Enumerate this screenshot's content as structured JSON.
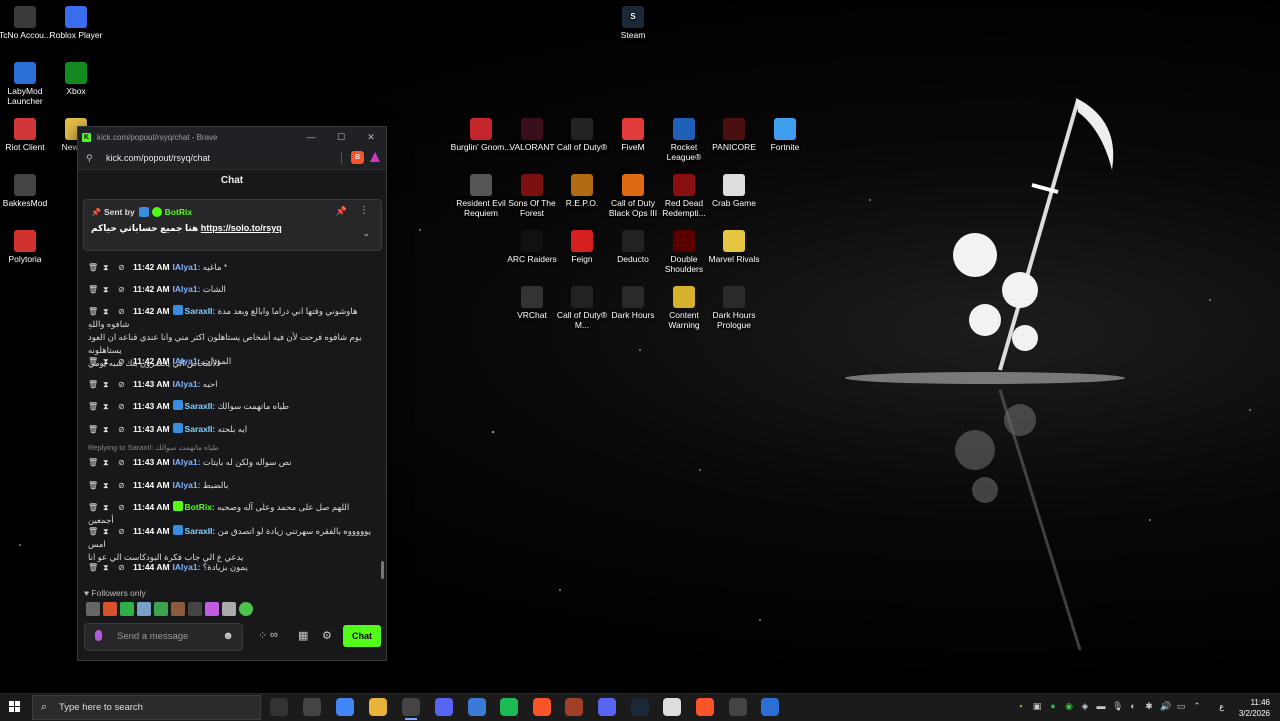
{
  "desktop": {
    "left_icons": [
      {
        "label": "TcNo Accou...",
        "icon": "tcno-icon",
        "color": "#3a3a3a"
      },
      {
        "label": "Roblox Player",
        "icon": "roblox-icon",
        "color": "#3b6df0"
      },
      {
        "label": "LabyMod Launcher",
        "icon": "labymod-icon",
        "color": "#2b6fd6"
      },
      {
        "label": "Xbox",
        "icon": "xbox-icon",
        "color": "#138a1e"
      },
      {
        "label": "Riot Client",
        "icon": "riot-icon",
        "color": "#d13639"
      },
      {
        "label": "New f...",
        "icon": "folder-icon",
        "color": "#e8c14a"
      },
      {
        "label": "BakkesMod",
        "icon": "bakkesmod-icon",
        "color": "#444"
      },
      {
        "label": "Polytoria",
        "icon": "polytoria-icon",
        "color": "#d2322d"
      }
    ],
    "steam_icon": {
      "label": "Steam",
      "icon": "steam-icon",
      "color": "#1b2838"
    },
    "grid_icons": [
      {
        "label": "Burglin' Gnom...",
        "icon": "burglin-gnomes-icon",
        "color": "#c3262b"
      },
      {
        "label": "VALORANT",
        "icon": "valorant-icon",
        "color": "#3a0e1a"
      },
      {
        "label": "Call of Duty®",
        "icon": "call-of-duty-icon",
        "color": "#222"
      },
      {
        "label": "FiveM",
        "icon": "fivem-icon",
        "color": "#e03a3a"
      },
      {
        "label": "Rocket League®",
        "icon": "rocket-league-icon",
        "color": "#1f5fb8"
      },
      {
        "label": "PANICORE",
        "icon": "panicore-icon",
        "color": "#4a1010"
      },
      {
        "label": "Fortnite",
        "icon": "fortnite-icon",
        "color": "#3f9ef0"
      },
      {
        "label": "Resident Evil Requiem",
        "icon": "resident-evil-icon",
        "color": "#555"
      },
      {
        "label": "Sons Of The Forest",
        "icon": "sons-of-the-forest-icon",
        "color": "#7a1010"
      },
      {
        "label": "R.E.P.O.",
        "icon": "repo-icon",
        "color": "#b36b12"
      },
      {
        "label": "Call of Duty Black Ops III",
        "icon": "black-ops-icon",
        "color": "#e06a12"
      },
      {
        "label": "Red Dead Redempti...",
        "icon": "red-dead-icon",
        "color": "#8a1010"
      },
      {
        "label": "Crab Game",
        "icon": "crab-game-icon",
        "color": "#ddd"
      },
      {
        "label": "ARC Raiders",
        "icon": "arc-raiders-icon",
        "color": "#111"
      },
      {
        "label": "Feign",
        "icon": "feign-icon",
        "color": "#d62020"
      },
      {
        "label": "Deducto",
        "icon": "deducto-icon",
        "color": "#222"
      },
      {
        "label": "Double Shoulders",
        "icon": "double-shoulders-icon",
        "color": "#5a0000"
      },
      {
        "label": "Marvel Rivals",
        "icon": "marvel-rivals-icon",
        "color": "#e4c640"
      },
      {
        "label": "VRChat",
        "icon": "vrchat-icon",
        "color": "#333"
      },
      {
        "label": "Call of Duty® M...",
        "icon": "cod-mw-icon",
        "color": "#222"
      },
      {
        "label": "Dark Hours",
        "icon": "dark-hours-icon",
        "color": "#2a2a2a"
      },
      {
        "label": "Content Warning",
        "icon": "content-warning-icon",
        "color": "#d6b12c"
      },
      {
        "label": "Dark Hours Prologue",
        "icon": "dark-hours-prologue-icon",
        "color": "#2a2a2a"
      }
    ]
  },
  "browser": {
    "title": "kick.com/popout/rsyq/chat - Brave",
    "url": "kick.com/popout/rsyq/chat",
    "chat_header": "Chat",
    "pinned": {
      "sent_by_label": "Sent by",
      "user": "BotRix",
      "text": "هنا جميع حساباتي حياكم",
      "link": "https://solo.to/rsyq"
    },
    "messages": [
      {
        "time": "11:42 AM",
        "user": "IAlya1:",
        "user_color": "#7fb5ff",
        "text": "ماغيه *",
        "badge": false
      },
      {
        "time": "11:42 AM",
        "user": "IAlya1:",
        "user_color": "#7fb5ff",
        "text": "الشات",
        "badge": false
      },
      {
        "time": "11:42 AM",
        "user": "SaraxII:",
        "user_color": "#7fd3ff",
        "text": "هاوشوني وفتها اني دراما وابالغ وبعد مدة شافوه واللهِ",
        "text2": "يوم شافوه فرحت لأن فيه أشخاص يستاهلون اكثر مني وانا عندي قناعه ان العود يستاهلونه",
        "text3": "الأشخاص الي يحضرون بثك شبه يومي",
        "badge": true
      },
      {
        "time": "11:42 AM",
        "user": "IAlya1:",
        "user_color": "#7fb5ff",
        "text": "المودات",
        "badge": false
      },
      {
        "time": "11:43 AM",
        "user": "IAlya1:",
        "user_color": "#7fb5ff",
        "text": "احبه",
        "badge": false
      },
      {
        "time": "11:43 AM",
        "user": "SaraxII:",
        "user_color": "#7fd3ff",
        "text": "طياه ماتهمت سوالك",
        "badge": true
      },
      {
        "time": "11:43 AM",
        "user": "SaraxII:",
        "user_color": "#7fd3ff",
        "text": "ايه بلحته",
        "badge": true
      },
      {
        "reply_label": "Replying to SaraxII:",
        "reply_text": "طياه ماتهمت سوالك"
      },
      {
        "time": "11:43 AM",
        "user": "IAlya1:",
        "user_color": "#7fb5ff",
        "text": "نص سواله ولكن له بايتات",
        "badge": false
      },
      {
        "time": "11:44 AM",
        "user": "IAlya1:",
        "user_color": "#7fb5ff",
        "text": "بالضبط",
        "badge": false
      },
      {
        "time": "11:44 AM",
        "user": "BotRix:",
        "user_color": "#53fc18",
        "text": "اللهم صل على محمد وعلى آله وصحبه أجمعين",
        "badge": true
      },
      {
        "time": "11:44 AM",
        "user": "SaraxII:",
        "user_color": "#7fd3ff",
        "text": "يوووووه بالفقره سهرتني زيادة لو اتصدق من امس",
        "text2": "يدعي ع الي جاب فكرة البودكاست الي عو انا",
        "badge": true
      },
      {
        "time": "11:44 AM",
        "user": "IAlya1:",
        "user_color": "#7fb5ff",
        "text": "يمون بزيادة؟",
        "badge": false
      }
    ],
    "followers_only": "Followers only",
    "input_placeholder": "Send a message",
    "chat_button": "Chat"
  },
  "taskbar": {
    "search_placeholder": "Type here to search",
    "apps": [
      "task-view-icon",
      "steam-small-icon",
      "chrome-icon",
      "file-explorer-icon",
      "obs-icon",
      "discord-ptb-icon",
      "app-window-icon",
      "spotify-icon",
      "brave-icon",
      "game-icon",
      "discord-icon",
      "steam-icon",
      "github-icon",
      "brave-beta-icon",
      "tcno-small-icon",
      "roblox-small-icon"
    ],
    "lang": "ع",
    "time": "11:46",
    "date": "3/2/2026"
  }
}
